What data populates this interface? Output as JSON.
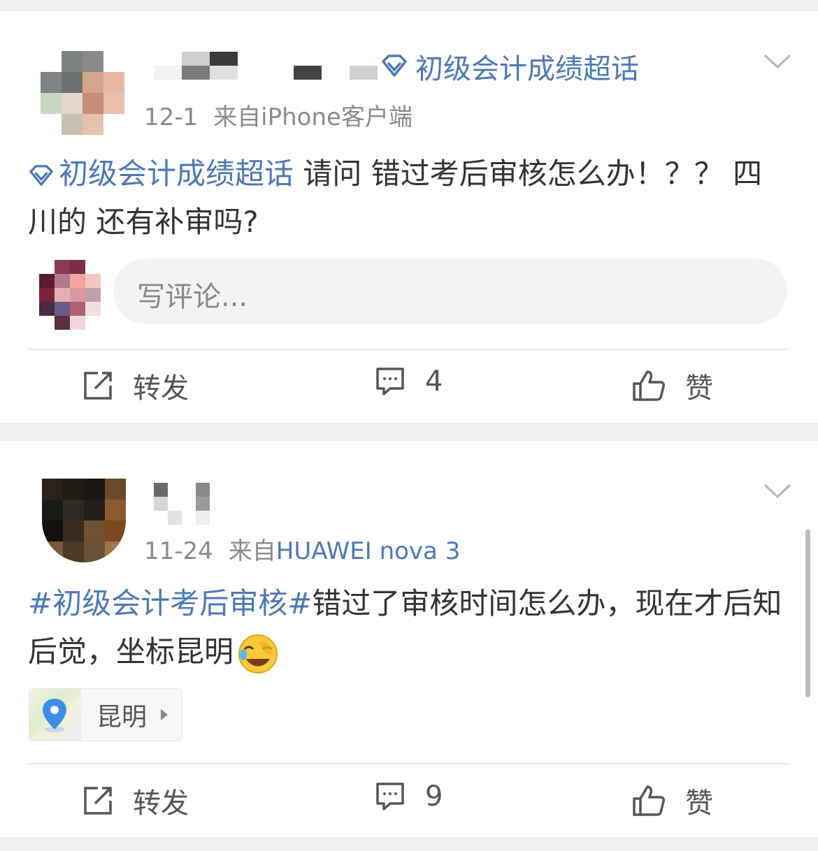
{
  "posts": [
    {
      "topic_badge": "初级会计成绩超话",
      "date": "12-1",
      "source_prefix": "来自",
      "source": "iPhone客户端",
      "topic_link": "初级会计成绩超话",
      "text": " 请问 错过考后审核怎么办！？？ 四川的  还有补审吗?",
      "comment_placeholder": "写评论...",
      "actions": {
        "repost": "转发",
        "comments": "4",
        "like": "赞"
      }
    },
    {
      "date": "11-24",
      "source_prefix": "来自",
      "source": "HUAWEI nova 3",
      "hashtag": "#初级会计考后审核#",
      "text": "错过了审核时间怎么办，现在才后知后觉，坐标昆明",
      "emoji": "face-with-tears-of-joy",
      "location": "昆明",
      "actions": {
        "repost": "转发",
        "comments": "9",
        "like": "赞"
      }
    }
  ],
  "colors": {
    "link": "#4b79b4",
    "text": "#333333",
    "meta": "#8a8a8a",
    "background": "#f0f0f0"
  },
  "icons": [
    "diamond-icon",
    "chevron-down-icon",
    "repost-icon",
    "comment-icon",
    "like-icon",
    "location-pin-icon",
    "emoji-laugh-icon"
  ]
}
